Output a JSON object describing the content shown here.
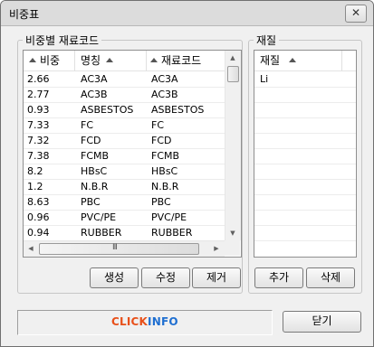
{
  "window": {
    "title": "비중표",
    "close_glyph": "✕"
  },
  "left_group": {
    "title": "비중별 재료코드",
    "columns": [
      "비중",
      "명칭",
      "재료코드"
    ],
    "rows": [
      {
        "weight": "2.66",
        "name": "AC3A",
        "code": "AC3A"
      },
      {
        "weight": "2.77",
        "name": "AC3B",
        "code": "AC3B"
      },
      {
        "weight": "0.93",
        "name": "ASBESTOS",
        "code": "ASBESTOS"
      },
      {
        "weight": "7.33",
        "name": "FC",
        "code": "FC"
      },
      {
        "weight": "7.32",
        "name": "FCD",
        "code": "FCD"
      },
      {
        "weight": "7.38",
        "name": "FCMB",
        "code": "FCMB"
      },
      {
        "weight": "8.2",
        "name": "HBsC",
        "code": "HBsC"
      },
      {
        "weight": "1.2",
        "name": "N.B.R",
        "code": "N.B.R"
      },
      {
        "weight": "8.63",
        "name": "PBC",
        "code": "PBC"
      },
      {
        "weight": "0.96",
        "name": "PVC/PE",
        "code": "PVC/PE"
      },
      {
        "weight": "0.94",
        "name": "RUBBER",
        "code": "RUBBER"
      }
    ],
    "buttons": {
      "create": "생성",
      "edit": "수정",
      "delete": "제거"
    }
  },
  "right_group": {
    "title": "재질",
    "column": "재질",
    "rows": [
      "Li"
    ],
    "buttons": {
      "add": "추가",
      "delete": "삭제"
    }
  },
  "status": {
    "logo_click": "CLICK",
    "logo_info": "INFO",
    "logo_click_color": "#e8501a",
    "logo_info_color": "#1f6fd1"
  },
  "footer": {
    "close_label": "닫기"
  }
}
